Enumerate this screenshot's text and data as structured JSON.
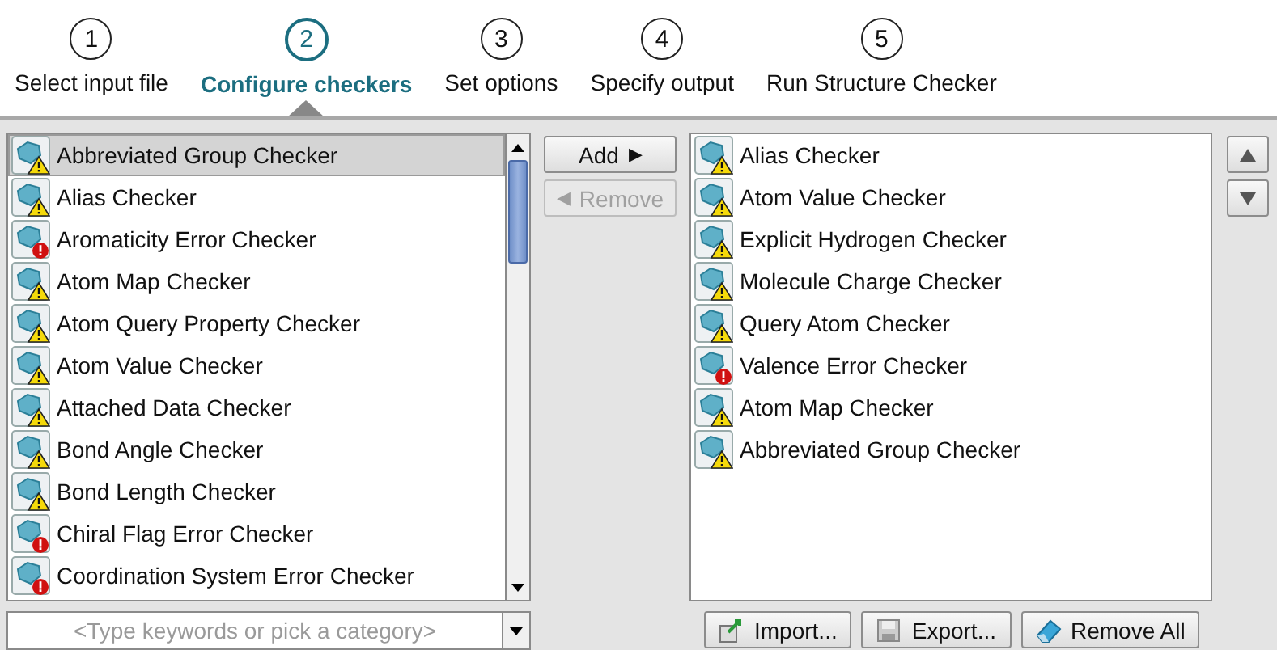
{
  "steps": [
    {
      "number": "1",
      "label": "Select input file",
      "selected": false
    },
    {
      "number": "2",
      "label": "Configure checkers",
      "selected": true
    },
    {
      "number": "3",
      "label": "Set options",
      "selected": false
    },
    {
      "number": "4",
      "label": "Specify output",
      "selected": false
    },
    {
      "number": "5",
      "label": "Run Structure Checker",
      "selected": false
    }
  ],
  "available_checkers": [
    {
      "name": "Abbreviated Group Checker",
      "kind": "warning",
      "selected": true
    },
    {
      "name": "Alias Checker",
      "kind": "warning",
      "selected": false
    },
    {
      "name": "Aromaticity Error Checker",
      "kind": "error",
      "selected": false
    },
    {
      "name": "Atom Map Checker",
      "kind": "warning",
      "selected": false
    },
    {
      "name": "Atom Query Property Checker",
      "kind": "warning",
      "selected": false
    },
    {
      "name": "Atom Value Checker",
      "kind": "warning",
      "selected": false
    },
    {
      "name": "Attached Data Checker",
      "kind": "warning",
      "selected": false
    },
    {
      "name": "Bond Angle Checker",
      "kind": "warning",
      "selected": false
    },
    {
      "name": "Bond Length Checker",
      "kind": "warning",
      "selected": false
    },
    {
      "name": "Chiral Flag Error Checker",
      "kind": "error",
      "selected": false
    },
    {
      "name": "Coordination System Error Checker",
      "kind": "error",
      "selected": false
    }
  ],
  "search": {
    "placeholder": "<Type keywords or pick a category>"
  },
  "transfer_buttons": [
    {
      "label": "Add",
      "icon": "▶",
      "kind": "add",
      "disabled": false
    },
    {
      "label": "Remove",
      "icon": "◀",
      "kind": "remove",
      "disabled": true
    }
  ],
  "selected_checkers": [
    {
      "name": "Alias Checker",
      "kind": "warning",
      "selected": false
    },
    {
      "name": "Atom Value Checker",
      "kind": "warning",
      "selected": false
    },
    {
      "name": "Explicit Hydrogen Checker",
      "kind": "warning",
      "selected": false
    },
    {
      "name": "Molecule Charge Checker",
      "kind": "warning",
      "selected": false
    },
    {
      "name": "Query Atom Checker",
      "kind": "warning",
      "selected": false
    },
    {
      "name": "Valence Error Checker",
      "kind": "error",
      "selected": false
    },
    {
      "name": "Atom Map Checker",
      "kind": "warning",
      "selected": false
    },
    {
      "name": "Abbreviated Group Checker",
      "kind": "warning",
      "selected": false
    }
  ],
  "order_buttons": [
    {
      "kind": "up"
    },
    {
      "kind": "down"
    }
  ],
  "bottom_buttons": [
    {
      "label": "Import...",
      "kind": "import"
    },
    {
      "label": "Export...",
      "kind": "export"
    },
    {
      "label": "Remove All",
      "kind": "remove-all"
    }
  ]
}
